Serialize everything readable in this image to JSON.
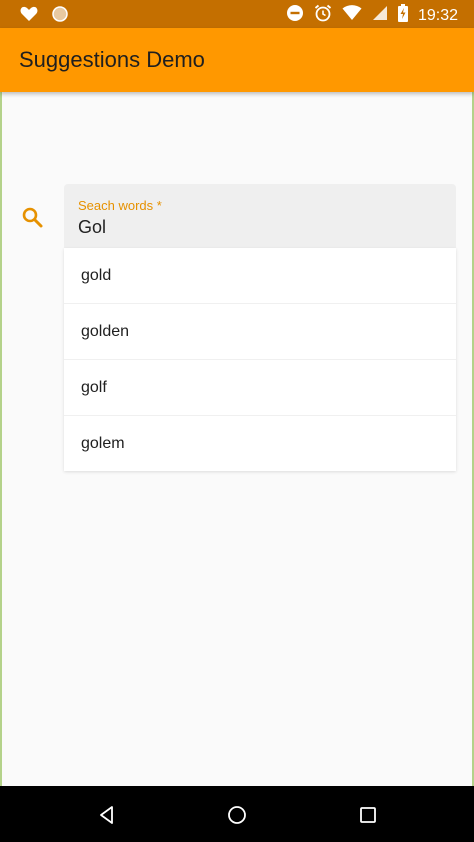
{
  "status_bar": {
    "time": "19:32",
    "icons": [
      "heart-icon",
      "circle-notification-icon",
      "do-not-disturb-icon",
      "alarm-icon",
      "wifi-icon",
      "signal-icon",
      "battery-charging-icon"
    ]
  },
  "app_bar": {
    "title": "Suggestions Demo"
  },
  "search": {
    "icon": "search-icon",
    "label": "Seach words *",
    "value": "Gol"
  },
  "suggestions": [
    "gold",
    "golden",
    "golf",
    "golem"
  ],
  "nav_bar": {
    "icons": [
      "back-icon",
      "home-icon",
      "recents-icon"
    ]
  },
  "colors": {
    "accent": "#ff9800",
    "status": "#c46f00",
    "label": "#e69100"
  }
}
